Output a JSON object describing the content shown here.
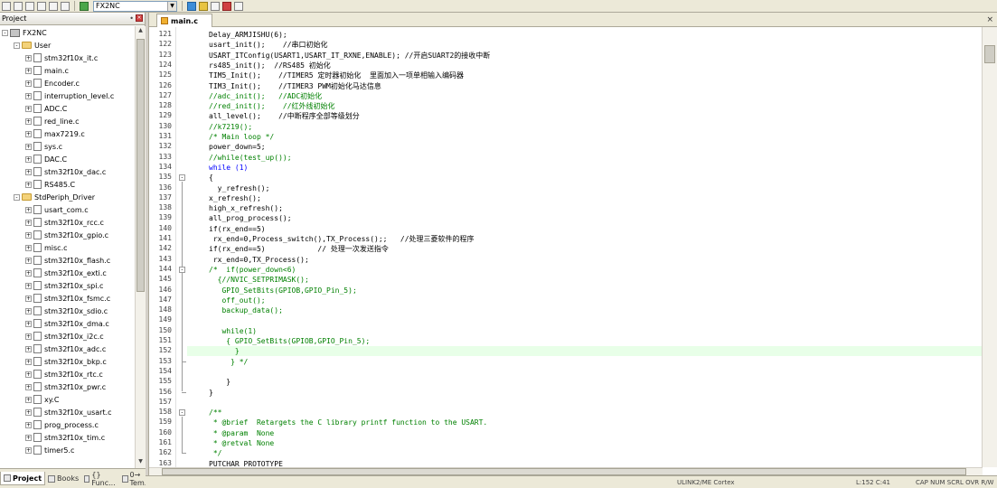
{
  "toolbar": {
    "target": "FX2NC"
  },
  "project_panel": {
    "title": "Project",
    "pin_glyph": "•",
    "close_glyph": "×",
    "tree": [
      {
        "label": "FX2NC",
        "type": "project",
        "depth": 0,
        "toggle": "-"
      },
      {
        "label": "User",
        "type": "folder",
        "depth": 1,
        "toggle": "-"
      },
      {
        "label": "stm32f10x_it.c",
        "type": "file",
        "depth": 2,
        "toggle": "+"
      },
      {
        "label": "main.c",
        "type": "file",
        "depth": 2,
        "toggle": "+"
      },
      {
        "label": "Encoder.c",
        "type": "file",
        "depth": 2,
        "toggle": "+"
      },
      {
        "label": "interruption_level.c",
        "type": "file",
        "depth": 2,
        "toggle": "+"
      },
      {
        "label": "ADC.C",
        "type": "file",
        "depth": 2,
        "toggle": "+"
      },
      {
        "label": "red_line.c",
        "type": "file",
        "depth": 2,
        "toggle": "+"
      },
      {
        "label": "max7219.c",
        "type": "file",
        "depth": 2,
        "toggle": "+"
      },
      {
        "label": "sys.c",
        "type": "file",
        "depth": 2,
        "toggle": "+"
      },
      {
        "label": "DAC.C",
        "type": "file",
        "depth": 2,
        "toggle": "+"
      },
      {
        "label": "stm32f10x_dac.c",
        "type": "file",
        "depth": 2,
        "toggle": "+"
      },
      {
        "label": "RS485.C",
        "type": "file",
        "depth": 2,
        "toggle": "+"
      },
      {
        "label": "StdPeriph_Driver",
        "type": "folder",
        "depth": 1,
        "toggle": "-"
      },
      {
        "label": "usart_com.c",
        "type": "file",
        "depth": 2,
        "toggle": "+"
      },
      {
        "label": "stm32f10x_rcc.c",
        "type": "file",
        "depth": 2,
        "toggle": "+"
      },
      {
        "label": "stm32f10x_gpio.c",
        "type": "file",
        "depth": 2,
        "toggle": "+"
      },
      {
        "label": "misc.c",
        "type": "file",
        "depth": 2,
        "toggle": "+"
      },
      {
        "label": "stm32f10x_flash.c",
        "type": "file",
        "depth": 2,
        "toggle": "+"
      },
      {
        "label": "stm32f10x_exti.c",
        "type": "file",
        "depth": 2,
        "toggle": "+"
      },
      {
        "label": "stm32f10x_spi.c",
        "type": "file",
        "depth": 2,
        "toggle": "+"
      },
      {
        "label": "stm32f10x_fsmc.c",
        "type": "file",
        "depth": 2,
        "toggle": "+"
      },
      {
        "label": "stm32f10x_sdio.c",
        "type": "file",
        "depth": 2,
        "toggle": "+"
      },
      {
        "label": "stm32f10x_dma.c",
        "type": "file",
        "depth": 2,
        "toggle": "+"
      },
      {
        "label": "stm32f10x_i2c.c",
        "type": "file",
        "depth": 2,
        "toggle": "+"
      },
      {
        "label": "stm32f10x_adc.c",
        "type": "file",
        "depth": 2,
        "toggle": "+"
      },
      {
        "label": "stm32f10x_bkp.c",
        "type": "file",
        "depth": 2,
        "toggle": "+"
      },
      {
        "label": "stm32f10x_rtc.c",
        "type": "file",
        "depth": 2,
        "toggle": "+"
      },
      {
        "label": "stm32f10x_pwr.c",
        "type": "file",
        "depth": 2,
        "toggle": "+"
      },
      {
        "label": "xy.C",
        "type": "file",
        "depth": 2,
        "toggle": "+"
      },
      {
        "label": "stm32f10x_usart.c",
        "type": "file",
        "depth": 2,
        "toggle": "+"
      },
      {
        "label": "prog_process.c",
        "type": "file",
        "depth": 2,
        "toggle": "+"
      },
      {
        "label": "stm32f10x_tim.c",
        "type": "file",
        "depth": 2,
        "toggle": "+"
      },
      {
        "label": "timer5.c",
        "type": "file",
        "depth": 2,
        "toggle": "+"
      }
    ],
    "tabs": [
      {
        "label": "Project",
        "active": true
      },
      {
        "label": "Books",
        "active": false
      },
      {
        "label": "{} Func...",
        "active": false
      },
      {
        "label": "0→ Tem...",
        "active": false
      }
    ]
  },
  "editor": {
    "tab": "main.c",
    "close_glyph": "×",
    "highlight_line": 152,
    "lines": [
      {
        "n": 121,
        "text": "Delay_ARMJISHU(6);",
        "style": "code"
      },
      {
        "n": 122,
        "text": "usart_init();    //串口初始化",
        "style": "code"
      },
      {
        "n": 123,
        "text": "USART_ITConfig(USART1,USART_IT_RXNE,ENABLE); //开启SUART2的接收中断",
        "style": "code"
      },
      {
        "n": 124,
        "text": "rs485_init();  //RS485 初始化",
        "style": "code"
      },
      {
        "n": 125,
        "text": "TIM5_Init();    //TIMER5 定时器初始化  里面加入一项单相输入编码器",
        "style": "code"
      },
      {
        "n": 126,
        "text": "TIM3_Init();    //TIMER3 PWM初始化马达信息",
        "style": "code"
      },
      {
        "n": 127,
        "text": "//adc_init();   //ADC初始化",
        "style": "cmt"
      },
      {
        "n": 128,
        "text": "//red_init();    //红外线初始化",
        "style": "cmt"
      },
      {
        "n": 129,
        "text": "all_level();    //中断程序全部等级划分",
        "style": "code"
      },
      {
        "n": 130,
        "text": "//k7219();",
        "style": "cmt"
      },
      {
        "n": 131,
        "text": "/* Main loop */",
        "style": "cmt"
      },
      {
        "n": 132,
        "text": "power_down=5;",
        "style": "code"
      },
      {
        "n": 133,
        "text": "//while(test_up());",
        "style": "cmt"
      },
      {
        "n": 134,
        "text": "while (1)",
        "style": "kw"
      },
      {
        "n": 135,
        "text": "{",
        "style": "code"
      },
      {
        "n": 136,
        "text": "  y_refresh();",
        "style": "code"
      },
      {
        "n": 137,
        "text": "x_refresh();",
        "style": "code"
      },
      {
        "n": 138,
        "text": "high_x_refresh();",
        "style": "code"
      },
      {
        "n": 139,
        "text": "all_prog_process();",
        "style": "code"
      },
      {
        "n": 140,
        "text": "if(rx_end==5)",
        "style": "code"
      },
      {
        "n": 141,
        "text": " rx_end=0,Process_switch(),TX_Process();;   //处理三菱软件的程序",
        "style": "code"
      },
      {
        "n": 142,
        "text": "if(rx_end==5)            // 处理一次发送指令",
        "style": "code"
      },
      {
        "n": 143,
        "text": " rx_end=0,TX_Process();",
        "style": "code"
      },
      {
        "n": 144,
        "text": "/*  if(power_down<6)",
        "style": "cmt"
      },
      {
        "n": 145,
        "text": "  {//NVIC_SETPRIMASK();",
        "style": "cmt"
      },
      {
        "n": 146,
        "text": "   GPIO_SetBits(GPIOB,GPIO_Pin_5);",
        "style": "cmt"
      },
      {
        "n": 147,
        "text": "   off_out();",
        "style": "cmt"
      },
      {
        "n": 148,
        "text": "   backup_data();",
        "style": "cmt"
      },
      {
        "n": 149,
        "text": "",
        "style": "cmt"
      },
      {
        "n": 150,
        "text": "   while(1)",
        "style": "cmt"
      },
      {
        "n": 151,
        "text": "    { GPIO_SetBits(GPIOB,GPIO_Pin_5);",
        "style": "cmt"
      },
      {
        "n": 152,
        "text": "      }",
        "style": "cmt"
      },
      {
        "n": 153,
        "text": "     } */",
        "style": "cmt"
      },
      {
        "n": 154,
        "text": "",
        "style": "code"
      },
      {
        "n": 155,
        "text": "    }",
        "style": "code"
      },
      {
        "n": 156,
        "text": "}",
        "style": "code"
      },
      {
        "n": 157,
        "text": "",
        "style": "code"
      },
      {
        "n": 158,
        "text": "/**",
        "style": "cmt"
      },
      {
        "n": 159,
        "text": " * @brief  Retargets the C library printf function to the USART.",
        "style": "cmt"
      },
      {
        "n": 160,
        "text": " * @param  None",
        "style": "cmt"
      },
      {
        "n": 161,
        "text": " * @retval None",
        "style": "cmt"
      },
      {
        "n": 162,
        "text": " */",
        "style": "cmt"
      },
      {
        "n": 163,
        "text": "PUTCHAR_PROTOTYPE",
        "style": "code"
      }
    ],
    "folds": [
      {
        "line": 135,
        "glyph": "-",
        "end": 156
      },
      {
        "line": 144,
        "glyph": "-",
        "end": 153
      },
      {
        "line": 158,
        "glyph": "-",
        "end": 162
      }
    ]
  },
  "status_bar": {
    "items": [
      "ULINK2/ME Cortex",
      "L:152 C:41",
      "CAP  NUM  SCRL  OVR  R/W"
    ]
  },
  "colors": {
    "comment": "#008000",
    "keyword": "#0000ff",
    "highlight": "#e8ffe8"
  }
}
